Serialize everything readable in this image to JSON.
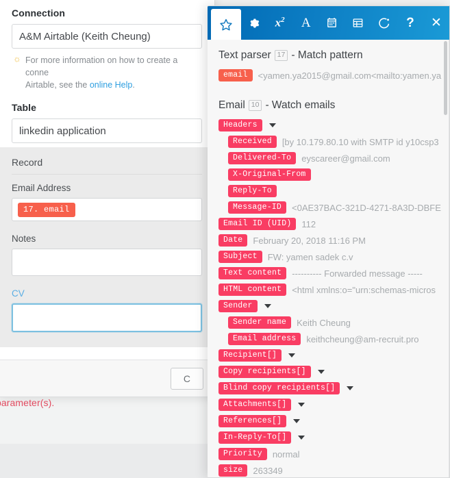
{
  "left_modal": {
    "connection_label": "Connection",
    "connection_value": "A&M Airtable (Keith Cheung)",
    "hint_line1": "For more information on how to create a conne",
    "hint_line2_pre": "Airtable, see the ",
    "hint_link": "online Help",
    "hint_line2_post": ".",
    "table_label": "Table",
    "table_value": "linkedin application",
    "record_title": "Record",
    "email_label": "Email Address",
    "email_chip": "17. email",
    "notes_label": "Notes",
    "notes_value": "",
    "cv_label": "CV",
    "cv_value": "",
    "cancel_label": "C",
    "error_text": "parameter(s)."
  },
  "right_panel": {
    "toolbar": [
      {
        "name": "favorites-icon",
        "glyph": "star",
        "active": true
      },
      {
        "name": "settings-icon",
        "glyph": "gear",
        "active": false
      },
      {
        "name": "math-functions-icon",
        "glyph": "x2",
        "active": false
      },
      {
        "name": "text-functions-icon",
        "glyph": "A",
        "active": false
      },
      {
        "name": "date-functions-icon",
        "glyph": "calendar",
        "active": false
      },
      {
        "name": "array-functions-icon",
        "glyph": "table",
        "active": false
      },
      {
        "name": "general-functions-icon",
        "glyph": "pie",
        "active": false
      },
      {
        "name": "help-icon",
        "glyph": "?",
        "active": false
      },
      {
        "name": "close-icon",
        "glyph": "x",
        "active": false
      }
    ],
    "sections": [
      {
        "title_prefix": "Text parser",
        "number": "17",
        "title_suffix": "- Match pattern",
        "rows": [
          {
            "tag": "email",
            "value": "<yamen.ya2015@gmail.com<mailto:yamen.ya",
            "indent": 0,
            "caret": false,
            "style": "orange"
          }
        ]
      },
      {
        "title_prefix": "Email",
        "number": "10",
        "title_suffix": "- Watch emails",
        "rows": [
          {
            "tag": "Headers",
            "value": "",
            "indent": 0,
            "caret": true,
            "style": "pink"
          },
          {
            "tag": "Received",
            "value": "[by 10.179.80.10 with SMTP id y10csp3",
            "indent": 1,
            "caret": false,
            "style": "pink"
          },
          {
            "tag": "Delivered-To",
            "value": "eyscareer@gmail.com",
            "indent": 1,
            "caret": false,
            "style": "pink"
          },
          {
            "tag": "X-Original-From",
            "value": "",
            "indent": 1,
            "caret": false,
            "style": "pink"
          },
          {
            "tag": "Reply-To",
            "value": "",
            "indent": 1,
            "caret": false,
            "style": "pink"
          },
          {
            "tag": "Message-ID",
            "value": "<0AE37BAC-321D-4271-8A3D-DBFE",
            "indent": 1,
            "caret": false,
            "style": "pink"
          },
          {
            "tag": "Email ID (UID)",
            "value": "112",
            "indent": 0,
            "caret": false,
            "style": "pink"
          },
          {
            "tag": "Date",
            "value": "February 20, 2018 11:16 PM",
            "indent": 0,
            "caret": false,
            "style": "pink"
          },
          {
            "tag": "Subject",
            "value": "FW: yamen sadek c.v",
            "indent": 0,
            "caret": false,
            "style": "pink"
          },
          {
            "tag": "Text content",
            "value": "---------- Forwarded message -----",
            "indent": 0,
            "caret": false,
            "style": "pink"
          },
          {
            "tag": "HTML content",
            "value": "<html xmlns:o=\"urn:schemas-micros",
            "indent": 0,
            "caret": false,
            "style": "pink"
          },
          {
            "tag": "Sender",
            "value": "",
            "indent": 0,
            "caret": true,
            "style": "pink"
          },
          {
            "tag": "Sender name",
            "value": "Keith Cheung",
            "indent": 1,
            "caret": false,
            "style": "pink"
          },
          {
            "tag": "Email address",
            "value": "keithcheung@am-recruit.pro",
            "indent": 1,
            "caret": false,
            "style": "pink"
          },
          {
            "tag": "Recipient[]",
            "value": "",
            "indent": 0,
            "caret": true,
            "style": "pink"
          },
          {
            "tag": "Copy recipients[]",
            "value": "",
            "indent": 0,
            "caret": true,
            "style": "pink"
          },
          {
            "tag": "Blind copy recipients[]",
            "value": "",
            "indent": 0,
            "caret": true,
            "style": "pink"
          },
          {
            "tag": "Attachments[]",
            "value": "",
            "indent": 0,
            "caret": true,
            "style": "pink"
          },
          {
            "tag": "References[]",
            "value": "",
            "indent": 0,
            "caret": true,
            "style": "pink"
          },
          {
            "tag": "In-Reply-To[]",
            "value": "",
            "indent": 0,
            "caret": true,
            "style": "pink"
          },
          {
            "tag": "Priority",
            "value": "normal",
            "indent": 0,
            "caret": false,
            "style": "pink"
          },
          {
            "tag": "size",
            "value": "263349",
            "indent": 0,
            "caret": false,
            "style": "pink"
          }
        ]
      }
    ]
  },
  "colors": {
    "pink_tag": "#f93d63",
    "orange_tag": "#f7604c",
    "toolbar_blue": "#0b76bd",
    "link_blue": "#2f9fe0",
    "error_red": "#e24b60"
  }
}
